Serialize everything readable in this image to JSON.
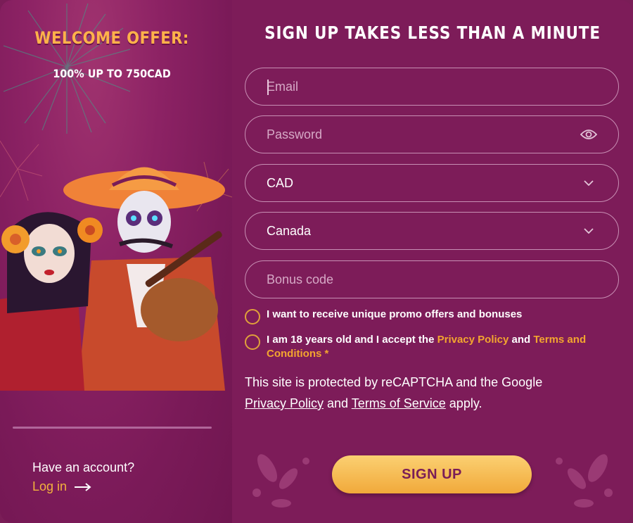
{
  "offer": {
    "title": "WELCOME OFFER:",
    "subtitle": "100% UP TO 750CAD"
  },
  "account": {
    "question": "Have an account?",
    "login_label": "Log in"
  },
  "form": {
    "title": "SIGN UP TAKES LESS THAN A MINUTE",
    "email_placeholder": "Email",
    "password_placeholder": "Password",
    "currency_value": "CAD",
    "country_value": "Canada",
    "bonus_placeholder": "Bonus code",
    "promo_checkbox_label": "I want to receive unique promo offers and bonuses",
    "age_checkbox": {
      "prefix": "I am 18 years old and I accept the ",
      "privacy_link": "Privacy Policy",
      "and": " and ",
      "terms_link": "Terms and Conditions",
      "required_mark": " *"
    },
    "captcha": {
      "prefix": "This site is protected by reCAPTCHA and the Google",
      "privacy_link": "Privacy Policy",
      "and": " and ",
      "terms_link": "Terms of Service",
      "suffix": " apply."
    },
    "submit_label": "SIGN UP"
  },
  "icons": {
    "password_toggle": "eye-icon",
    "select_caret": "chevron-down-icon",
    "login_arrow": "arrow-right-icon"
  },
  "colors": {
    "background": "#7d1c59",
    "accent": "#f3a52f",
    "button_gradient_top": "#fbd072",
    "button_gradient_bottom": "#f1a93a",
    "button_text": "#7a1d57"
  }
}
